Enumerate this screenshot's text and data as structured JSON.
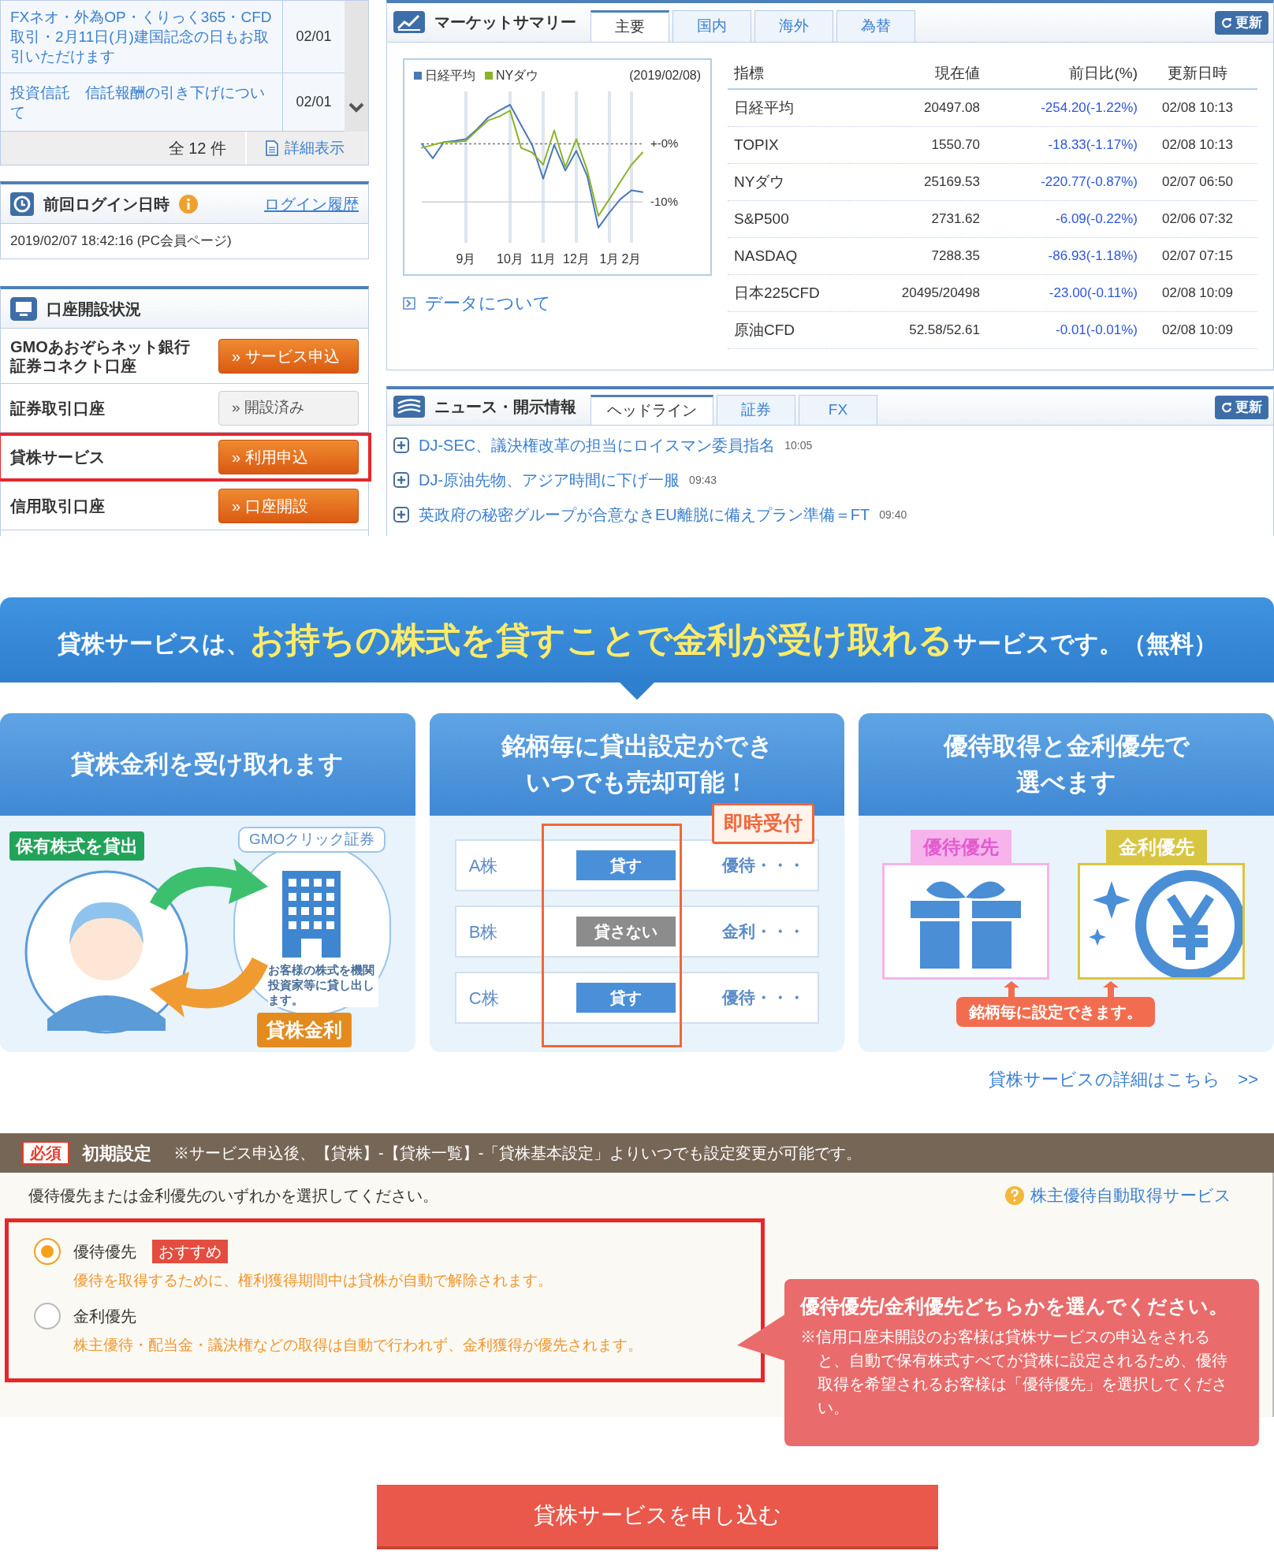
{
  "notices": {
    "rows": [
      {
        "text": "FXネオ・外為OP・くりっく365・CFD取引・2月11日(月)建国記念の日もお取引いただけます",
        "date": "02/01"
      },
      {
        "text": "投資信託　信託報酬の引き下げについて",
        "date": "02/01"
      }
    ],
    "count": "全 12 件",
    "detail_link": "詳細表示"
  },
  "last_login": {
    "title": "前回ログイン日時",
    "history_link": "ログイン履歴",
    "value": "2019/02/07 18:42:16 (PC会員ページ)"
  },
  "accounts": {
    "title": "口座開設状況",
    "rows": [
      {
        "lines": [
          "GMOあおぞらネット銀行",
          "証券コネクト口座"
        ],
        "button": "» サービス申込",
        "kind": "apply",
        "highlighted": false
      },
      {
        "lines": [
          "証券取引口座"
        ],
        "button": "» 開設済み",
        "kind": "done",
        "highlighted": false
      },
      {
        "lines": [
          "貸株サービス"
        ],
        "button": "» 利用申込",
        "kind": "apply",
        "highlighted": true
      },
      {
        "lines": [
          "信用取引口座"
        ],
        "button": "» 口座開設",
        "kind": "apply",
        "highlighted": false
      }
    ]
  },
  "market": {
    "title": "マーケットサマリー",
    "tabs": [
      {
        "label": "主要",
        "selected": true
      },
      {
        "label": "国内",
        "selected": false
      },
      {
        "label": "海外",
        "selected": false
      },
      {
        "label": "為替",
        "selected": false
      }
    ],
    "refresh": "更新",
    "chart_date": "(2019/02/08)",
    "chart_data": {
      "type": "line",
      "categories": [
        null,
        null,
        null,
        null,
        "9月",
        null,
        null,
        null,
        "10月",
        null,
        null,
        "11月",
        null,
        null,
        "12月",
        null,
        null,
        "1月",
        null,
        "2月",
        null
      ],
      "series": [
        {
          "name": "日経平均",
          "color": "#4a78b8",
          "values": [
            0,
            -2.5,
            0.3,
            0.5,
            0.8,
            2.5,
            4.5,
            5.7,
            6.7,
            3.2,
            -0.2,
            -6,
            -0.2,
            -4.6,
            -1.2,
            -5.6,
            -14.4,
            -11.8,
            -9.5,
            -8,
            -8.3
          ]
        },
        {
          "name": "NYダウ",
          "color": "#8ab42a",
          "values": [
            -0.7,
            -0.2,
            0.3,
            0.3,
            0.5,
            2.3,
            4,
            4.7,
            5.7,
            -0.7,
            -1.5,
            -3.6,
            2.3,
            -4,
            0.8,
            -4.6,
            -12.4,
            -9.5,
            -6.5,
            -3.6,
            -1.5
          ]
        }
      ],
      "ylim": [
        -17,
        9
      ],
      "grid": true,
      "ref_lines": [
        {
          "axis": "y",
          "value": 0
        },
        {
          "axis": "y",
          "value": -10
        }
      ],
      "yticks": [
        {
          "value": 0,
          "label": "+-0%"
        },
        {
          "value": -10,
          "label": "-10%"
        }
      ]
    },
    "data_link": "データについて",
    "columns": [
      "指標",
      "現在値",
      "前日比(%)",
      "更新日時"
    ],
    "rows": [
      [
        "日経平均",
        "20497.08",
        "-254.20(-1.22%)",
        "02/08 10:13"
      ],
      [
        "TOPIX",
        "1550.70",
        "-18.33(-1.17%)",
        "02/08 10:13"
      ],
      [
        "NYダウ",
        "25169.53",
        "-220.77(-0.87%)",
        "02/07 06:50"
      ],
      [
        "S&P500",
        "2731.62",
        "-6.09(-0.22%)",
        "02/06 07:32"
      ],
      [
        "NASDAQ",
        "7288.35",
        "-86.93(-1.18%)",
        "02/07 07:15"
      ],
      [
        "日本225CFD",
        "20495/20498",
        "-23.00(-0.11%)",
        "02/08 10:09"
      ],
      [
        "原油CFD",
        "52.58/52.61",
        "-0.01(-0.01%)",
        "02/08 10:09"
      ]
    ]
  },
  "news": {
    "title": "ニュース・開示情報",
    "tabs": [
      {
        "label": "ヘッドライン",
        "selected": true
      },
      {
        "label": "証券",
        "selected": false
      },
      {
        "label": "FX",
        "selected": false
      }
    ],
    "refresh": "更新",
    "items": [
      {
        "headline": "DJ-SEC、議決権改革の担当にロイスマン委員指名",
        "time": "10:05"
      },
      {
        "headline": "DJ-原油先物、アジア時間に下げ一服",
        "time": "09:43"
      },
      {
        "headline": "英政府の秘密グループが合意なきEU離脱に備えプラン準備＝FT",
        "time": "09:40"
      }
    ]
  },
  "banner": "貸株サービスは、**お持ちの株式を貸すことで金利が受け取れる**サービスです。（無料）",
  "cards": [
    {
      "kind": "interest",
      "title_lines": [
        "貸株金利を受け取れます"
      ],
      "lend_label": "保有株式を貸出",
      "broker": "GMOクリック証券",
      "note": "お客様の株式を機関投資家等に貸し出します。",
      "interest_label": "貸株金利"
    },
    {
      "kind": "per_stock",
      "title_lines": [
        "銘柄毎に貸出設定ができ",
        "いつでも売却可能！"
      ],
      "callout": "即時受付",
      "rows": [
        {
          "stock": "A株",
          "action": "貸す",
          "lend": true,
          "preference": "優待・・・"
        },
        {
          "stock": "B株",
          "action": "貸さない",
          "lend": false,
          "preference": "金利・・・"
        },
        {
          "stock": "C株",
          "action": "貸す",
          "lend": true,
          "preference": "優待・・・"
        }
      ]
    },
    {
      "kind": "priority",
      "title_lines": [
        "優待取得と金利優先で",
        "選べます"
      ],
      "gift_label": "優待優先",
      "yen_label": "金利優先",
      "footer": "銘柄毎に設定できます。"
    }
  ],
  "details_link": "貸株サービスの詳細はこちら　>>",
  "settings": {
    "required": "必須",
    "title": "初期設定",
    "note": "※サービス申込後、【貸株】-【貸株一覧】-「貸株基本設定」よりいつでも設定変更が可能です。",
    "instruction": "優待優先または金利優先のいずれかを選択してください。",
    "help_link": "株主優待自動取得サービス",
    "options": [
      {
        "label": "優待優先",
        "badge": "おすすめ",
        "description": "優待を取得するために、権利獲得期間中は貸株が自動で解除されます。",
        "selected": true
      },
      {
        "label": "金利優先",
        "description": "株主優待・配当金・議決権などの取得は自動で行われず、金利獲得が優先されます。",
        "selected": false
      }
    ],
    "callout_title": "優待優先/金利優先どちらかを選んでください。",
    "callout_body": "※信用口座未開設のお客様は貸株サービスの申込をされると、自動で保有株式すべてが貸株に設定されるため、優待取得を希望されるお客様は「優待優先」を選択してください。"
  },
  "submit": "貸株サービスを申し込む"
}
